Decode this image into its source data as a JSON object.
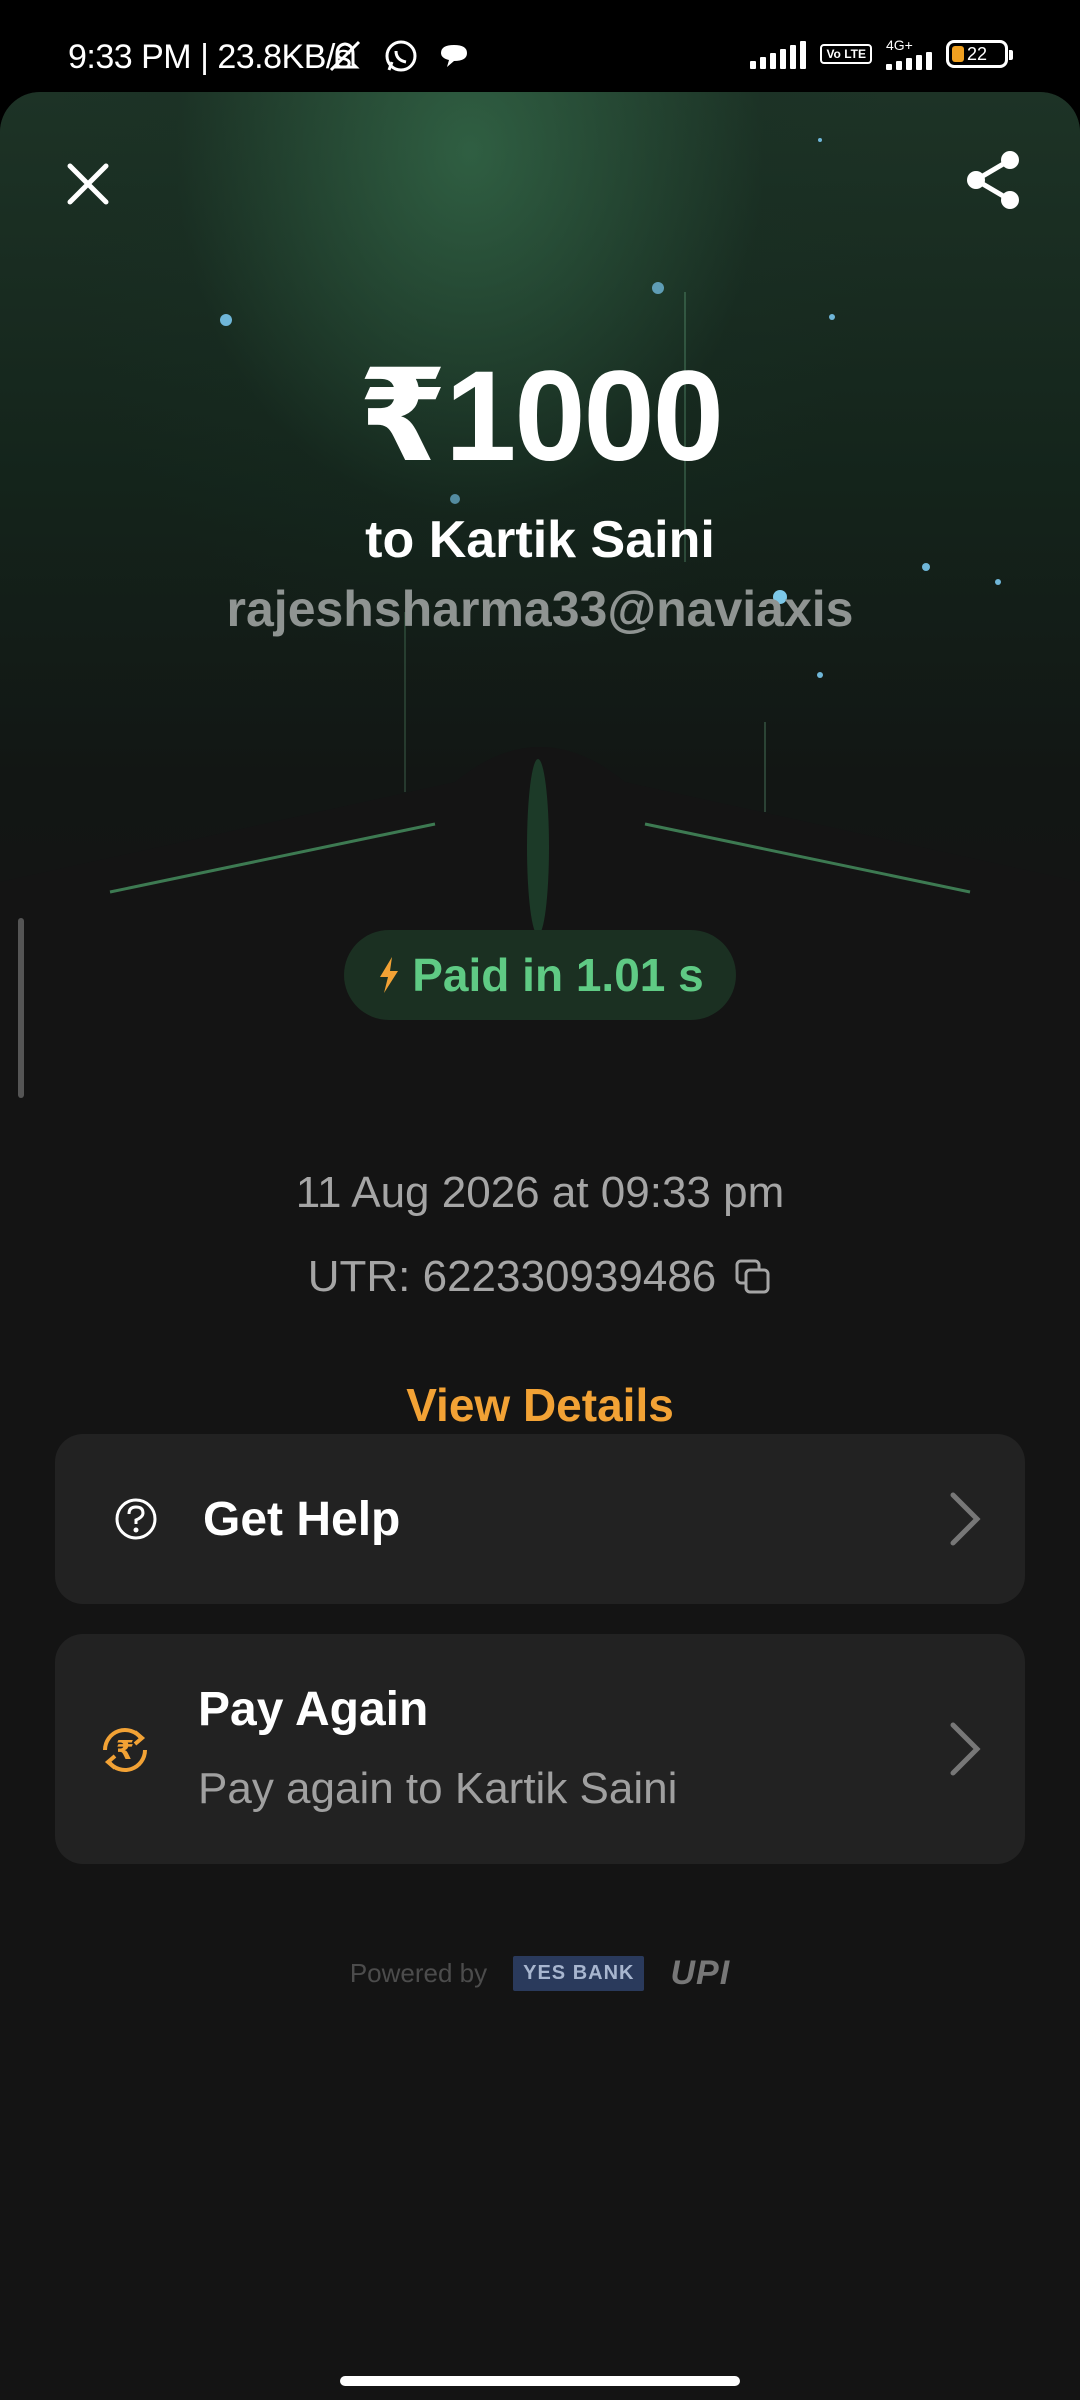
{
  "status_bar": {
    "time": "9:33 PM | 23.8KB/s",
    "volte": "Vo LTE",
    "network": "4G+",
    "battery": "22"
  },
  "header": {
    "close_icon": "close-icon",
    "share_icon": "share-icon"
  },
  "payment": {
    "amount": "₹1000",
    "recipient": "to Kartik  Saini",
    "upi_id": "rajeshsharma33@naviaxis",
    "paid_label": "Paid in 1.01 s",
    "date": "11 Aug 2026 at 09:33 pm",
    "utr": "UTR: 622330939486",
    "view_details": "View Details"
  },
  "actions": {
    "help": {
      "title": "Get Help",
      "icon": "help-circle-icon"
    },
    "pay_again": {
      "title": "Pay Again",
      "subtitle": "Pay again to Kartik  Saini",
      "icon": "rupee-refresh-icon"
    }
  },
  "footer": {
    "powered_by": "Powered by",
    "bank": "YES BANK",
    "upi": "UPI"
  },
  "colors": {
    "accent": "#f2a235",
    "success": "#5fca84",
    "background": "#141414",
    "card": "#222222"
  }
}
